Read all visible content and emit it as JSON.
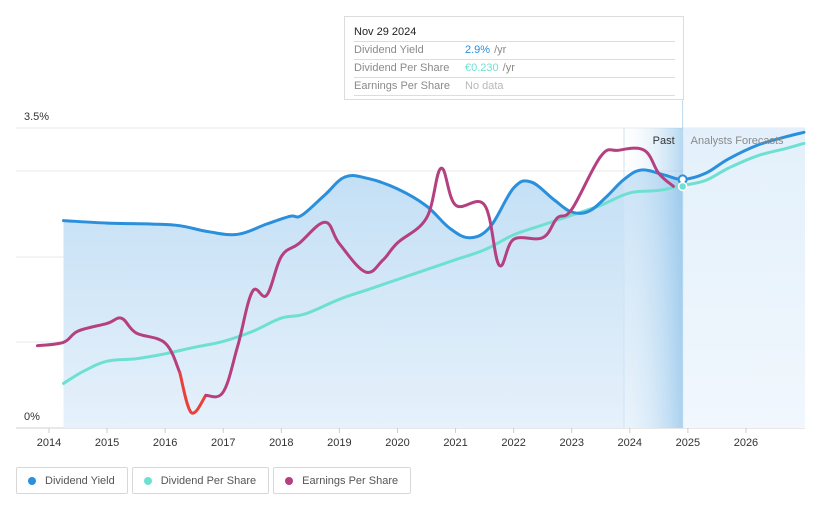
{
  "tooltip": {
    "date": "Nov 29 2024",
    "rows": [
      {
        "label": "Dividend Yield",
        "value": "2.9%",
        "unit": "/yr",
        "color": "#2a8fdc"
      },
      {
        "label": "Dividend Per Share",
        "value": "€0.230",
        "unit": "/yr",
        "color": "#6ee0d2"
      },
      {
        "label": "Earnings Per Share",
        "value": "No data",
        "unit": "",
        "color": "#b8b8b8"
      }
    ]
  },
  "regions": {
    "past_label": "Past",
    "forecast_label": "Analysts Forecasts"
  },
  "legend": [
    {
      "label": "Dividend Yield",
      "color": "#2a8fdc"
    },
    {
      "label": "Dividend Per Share",
      "color": "#6ee0d2"
    },
    {
      "label": "Earnings Per Share",
      "color": "#b5407f"
    }
  ],
  "colors": {
    "dividend_yield": "#2a8fdc",
    "dividend_per_share": "#6ee0d2",
    "earnings_per_share": "#b5407f",
    "eps_negative": "#e8413b",
    "area_fill": "#cfe4f6",
    "forecast_fill": "#e6f2fb"
  },
  "chart_data": {
    "type": "line",
    "title": "",
    "xlabel": "",
    "ylabel": "",
    "x_ticks": [
      "2014",
      "2015",
      "2016",
      "2017",
      "2018",
      "2019",
      "2020",
      "2021",
      "2022",
      "2023",
      "2024",
      "2025",
      "2026"
    ],
    "xlim": [
      2013.8,
      2027.0
    ],
    "y_tick_labels": [
      "0%",
      "3.5%"
    ],
    "ylim": [
      0,
      3.5
    ],
    "grid": true,
    "legend_position": "bottom-left",
    "past_region": [
      2023.9,
      2024.91
    ],
    "forecast_start": 2024.91,
    "highlight_date": 2024.91,
    "series": [
      {
        "name": "Dividend Yield",
        "unit": "%",
        "x": [
          2014.25,
          2015.0,
          2015.75,
          2016.25,
          2016.75,
          2017.25,
          2017.75,
          2018.15,
          2018.35,
          2018.75,
          2019.1,
          2019.5,
          2020.0,
          2020.5,
          2020.9,
          2021.25,
          2021.6,
          2022.0,
          2022.3,
          2022.7,
          2023.0,
          2023.3,
          2023.6,
          2023.9,
          2024.2,
          2024.6,
          2024.91,
          2025.3,
          2025.7,
          2026.2,
          2026.7,
          2027.0
        ],
        "values": [
          2.42,
          2.39,
          2.38,
          2.36,
          2.29,
          2.26,
          2.38,
          2.47,
          2.48,
          2.72,
          2.93,
          2.91,
          2.79,
          2.59,
          2.33,
          2.22,
          2.35,
          2.8,
          2.87,
          2.66,
          2.52,
          2.53,
          2.7,
          2.9,
          3.01,
          2.95,
          2.9,
          2.97,
          3.14,
          3.3,
          3.4,
          3.45
        ]
      },
      {
        "name": "Dividend Per Share",
        "unit": "EUR",
        "x": [
          2014.25,
          2014.6,
          2015.0,
          2015.5,
          2016.0,
          2016.5,
          2017.0,
          2017.5,
          2018.0,
          2018.4,
          2019.0,
          2019.5,
          2020.0,
          2020.5,
          2021.0,
          2021.5,
          2022.0,
          2022.5,
          2023.0,
          2023.5,
          2024.0,
          2024.5,
          2024.91,
          2025.3,
          2025.7,
          2026.2,
          2026.7,
          2027.0
        ],
        "values": [
          0.09,
          0.115,
          0.135,
          0.14,
          0.15,
          0.163,
          0.175,
          0.195,
          0.222,
          0.23,
          0.26,
          0.28,
          0.3,
          0.32,
          0.34,
          0.36,
          0.39,
          0.41,
          0.43,
          0.45,
          0.475,
          0.48,
          0.49,
          0.5,
          0.525,
          0.55,
          0.565,
          0.575
        ]
      },
      {
        "name": "Earnings Per Share",
        "unit": "EUR",
        "x": [
          2013.8,
          2014.25,
          2014.5,
          2015.0,
          2015.25,
          2015.5,
          2016.0,
          2016.25,
          2016.45,
          2016.7,
          2017.0,
          2017.25,
          2017.5,
          2017.75,
          2018.0,
          2018.3,
          2018.75,
          2019.0,
          2019.45,
          2019.75,
          2020.0,
          2020.5,
          2020.75,
          2021.0,
          2021.5,
          2021.75,
          2022.0,
          2022.5,
          2022.75,
          2023.0,
          2023.5,
          2023.8,
          2024.25,
          2024.5,
          2024.75
        ],
        "values": [
          0.96,
          1.0,
          1.13,
          1.22,
          1.28,
          1.11,
          0.99,
          0.65,
          0.18,
          0.38,
          0.42,
          0.96,
          1.59,
          1.55,
          2.0,
          2.15,
          2.4,
          2.15,
          1.82,
          1.96,
          2.16,
          2.45,
          3.03,
          2.6,
          2.6,
          1.9,
          2.2,
          2.22,
          2.45,
          2.55,
          3.17,
          3.24,
          3.24,
          2.97,
          2.82
        ]
      }
    ]
  }
}
